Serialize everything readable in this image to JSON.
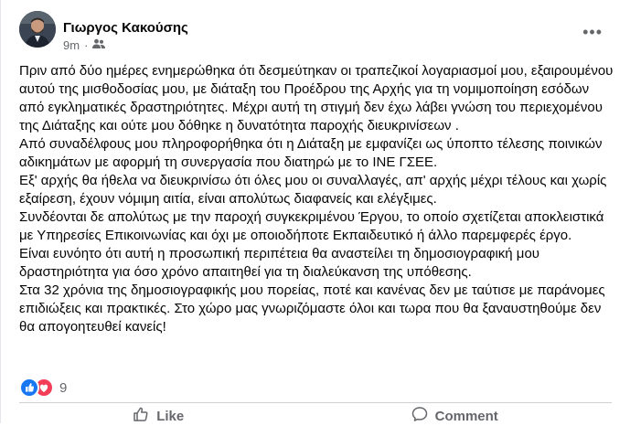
{
  "post": {
    "author": "Γιωργος Κακούσης",
    "time": "9m",
    "separator": "·",
    "paragraphs": [
      "Πριν από δύο ημέρες ενημερώθηκα ότι δεσμεύτηκαν οι τραπεζικοί λογαριασμοί μου, εξαιρουμένου αυτού της μισθοδοσίας μου, με διάταξη του Προέδρου της Αρχής για τη νομιμοποίηση εσόδων από εγκληματικές δραστηριότητες. Μέχρι αυτή τη στιγμή δεν έχω λάβει γνώση του περιεχομένου της Διάταξης και ούτε μου δόθηκε η δυνατότητα παροχής διευκρινίσεων .",
      "Από συναδέλφους μου πληροφορήθηκα ότι η Διάταξη με εμφανίζει ως ύποπτο τέλεσης ποινικών αδικημάτων με αφορμή τη συνεργασία που διατηρώ με το ΙΝΕ ΓΣΕΕ.",
      "Εξ' αρχής θα ήθελα να διευκρινίσω ότι όλες μου οι συναλλαγές, απ' αρχής μέχρι τέλους και χωρίς εξαίρεση, έχουν νόμιμη αιτία, είναι απολύτως διαφανείς και ελέγξιμες.",
      " Συνδέονται δε απολύτως με την παροχή συγκεκριμένου Έργου, το οποίο σχετίζεται αποκλειστικά με Υπηρεσίες Επικοινωνίας και όχι με οποιοδήποτε Εκπαιδευτικό ή άλλο παρεμφερές έργο.",
      "Είναι ευνόητο ότι αυτή η προσωπική περιπέτεια θα αναστείλει τη δημοσιογραφική μου δραστηριότητα για όσο χρόνο απαιτηθεί για τη διαλεύκανση της υπόθεσης.",
      "Στα 32 χρόνια της δημοσιογραφικής μου πορείας, ποτέ και κανένας δεν με ταύτισε  με παράνομες επιδιώξεις και πρακτικές. Στο χώρο μας γνωριζόμαστε όλοι και τωρα που θα ξαναυστηθούμε δεν θα απογοητευθεί κανείς!"
    ],
    "reaction_count": "9",
    "actions": {
      "like": "Like",
      "comment": "Comment"
    }
  },
  "icons": {
    "privacy": "friends-icon",
    "more": "more-options-icon",
    "like_reaction": "like-reaction-icon",
    "love_reaction": "love-reaction-icon",
    "like_action": "thumbs-up-icon",
    "comment_action": "comment-bubble-icon"
  },
  "colors": {
    "accent": "#1877f2",
    "love": "#f33e58",
    "secondary_text": "#65676b"
  }
}
